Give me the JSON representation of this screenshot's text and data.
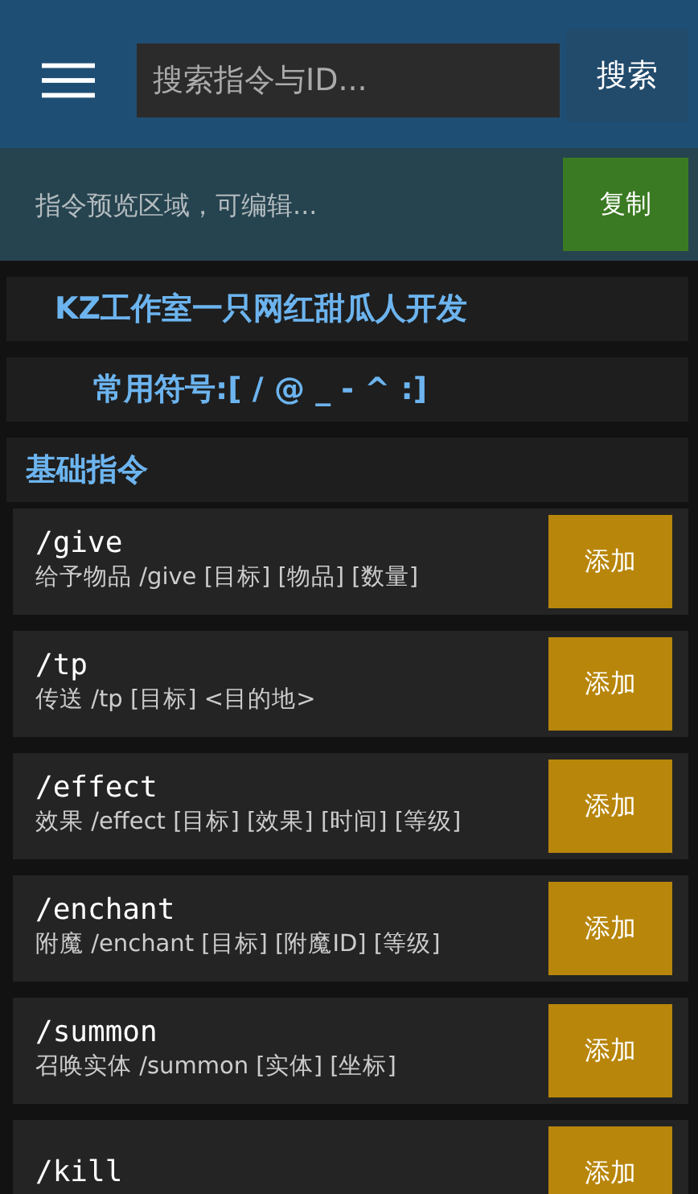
{
  "toolbar": {
    "search_placeholder": "搜索指令与ID...",
    "search_button": "搜索"
  },
  "preview": {
    "placeholder": "指令预览区域，可编辑...",
    "copy_button": "复制"
  },
  "notices": [
    "KZ工作室一只网红甜瓜人开发",
    "常用符号:[ / @ _ - ^ :]"
  ],
  "section": {
    "title": "基础指令",
    "commands": [
      {
        "name": "/give",
        "description": "给予物品 /give [目标] [物品] [数量]",
        "button": "添加"
      },
      {
        "name": "/tp",
        "description": "传送 /tp [目标] <目的地>",
        "button": "添加"
      },
      {
        "name": "/effect",
        "description": "效果 /effect [目标] [效果] [时间] [等级]",
        "button": "添加"
      },
      {
        "name": "/enchant",
        "description": "附魔 /enchant [目标] [附魔ID] [等级]",
        "button": "添加"
      },
      {
        "name": "/summon",
        "description": "召唤实体 /summon [实体] [坐标]",
        "button": "添加"
      },
      {
        "name": "/kill",
        "button": "添加"
      }
    ]
  }
}
